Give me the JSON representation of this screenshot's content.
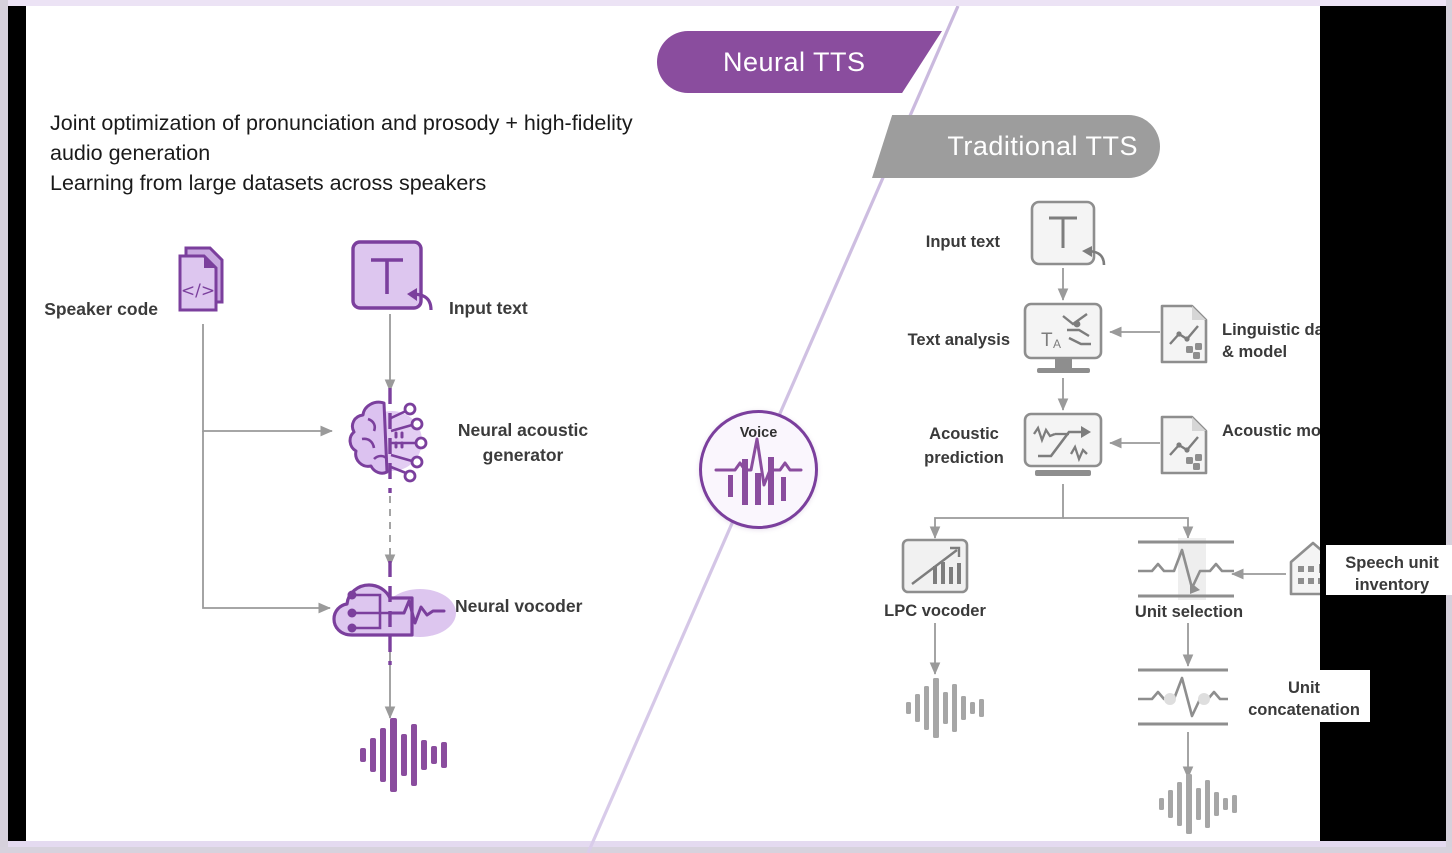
{
  "slide": {
    "background_color": "#ffffff",
    "accent_purple": "#8a4d9e",
    "accent_grey": "#9d9d9d"
  },
  "banners": {
    "neural": {
      "label": "Neural TTS",
      "color": "#8a4d9e"
    },
    "traditional": {
      "label": "Traditional TTS",
      "color": "#9d9d9d"
    }
  },
  "intro": {
    "line1": "Joint optimization of pronunciation and prosody + high-fidelity",
    "line2": "audio generation",
    "line3": "Learning from large datasets across speakers"
  },
  "center": {
    "voice_label": "Voice",
    "voice_icon": "voice-waveform-icon"
  },
  "neural_pipeline": {
    "nodes": [
      {
        "id": "speaker-code",
        "label": "Speaker code",
        "icon": "code-document-icon"
      },
      {
        "id": "input-text",
        "label": "Input text",
        "icon": "text-box-icon"
      },
      {
        "id": "neural-acoustic-generator",
        "label_line1": "Neural acoustic",
        "label_line2": "generator",
        "icon": "brain-circuit-icon"
      },
      {
        "id": "neural-vocoder",
        "label": "Neural vocoder",
        "icon": "cloud-circuit-waveform-icon"
      },
      {
        "id": "neural-output",
        "label": "",
        "icon": "audio-waveform-icon"
      }
    ]
  },
  "traditional_pipeline": {
    "nodes": [
      {
        "id": "input-text",
        "label": "Input text",
        "icon": "text-box-icon"
      },
      {
        "id": "text-analysis",
        "label": "Text analysis",
        "icon": "monitor-text-analysis-icon"
      },
      {
        "id": "linguistic-data",
        "label_line1": "Linguistic data",
        "label_line2": "& model",
        "icon": "document-chart-icon"
      },
      {
        "id": "acoustic-prediction",
        "label_line1": "Acoustic",
        "label_line2": "prediction",
        "icon": "monitor-acoustic-icon"
      },
      {
        "id": "acoustic-model",
        "label": "Acoustic model",
        "icon": "document-chart-icon"
      },
      {
        "id": "lpc-vocoder",
        "label": "LPC vocoder",
        "icon": "chart-bars-icon"
      },
      {
        "id": "unit-selection",
        "label": "Unit selection",
        "icon": "waveform-segment-icon"
      },
      {
        "id": "speech-unit-inventory",
        "label_line1": "Speech unit",
        "label_line2": "inventory",
        "icon": "warehouse-icon"
      },
      {
        "id": "unit-concatenation",
        "label_line1": "Unit",
        "label_line2": "concatenation",
        "icon": "waveform-join-icon"
      },
      {
        "id": "lpc-output",
        "label": "",
        "icon": "audio-waveform-icon"
      },
      {
        "id": "unit-output",
        "label": "",
        "icon": "audio-waveform-icon"
      }
    ]
  }
}
